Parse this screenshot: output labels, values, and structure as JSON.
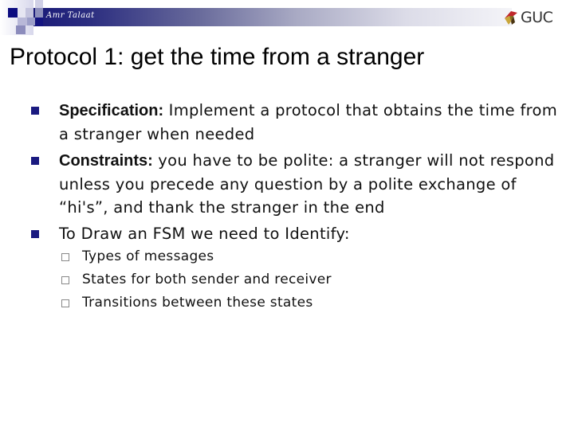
{
  "header": {
    "author": "Amr Talaat",
    "logo_text": "GUC",
    "band_color": "#1a1a78"
  },
  "slide": {
    "title": "Protocol 1: get the time from a stranger",
    "bullets": [
      {
        "label": "Specification:",
        "text": " Implement a protocol that obtains the time from a stranger when needed"
      },
      {
        "label": "Constraints:",
        "text": " you have to be polite: a stranger will not respond unless you precede any question by a polite exchange of “hi's”, and thank the stranger in the end"
      },
      {
        "label": "",
        "text": "To Draw an FSM we need to Identify:"
      }
    ],
    "sub_bullets": [
      "Types of messages",
      "States for both sender and receiver",
      "Transitions between these states"
    ]
  },
  "colors": {
    "bullet": "#1a1a80",
    "sub_bullet_border": "#888888",
    "text": "#111111"
  }
}
